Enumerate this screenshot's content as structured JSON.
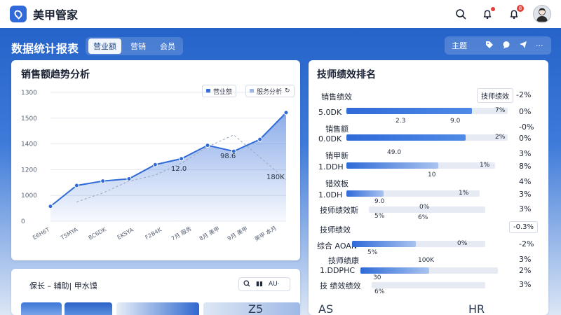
{
  "app": {
    "title": "美甲管家",
    "notification_badge": "8"
  },
  "page": {
    "title": "数据统计报表",
    "tabs": [
      {
        "label": "营业额",
        "active": true
      },
      {
        "label": "营销"
      },
      {
        "label": "会员"
      }
    ],
    "toolbar": {
      "label": "主题"
    }
  },
  "sales_chart": {
    "title": "销售额趋势分析",
    "legend": [
      "营业额",
      "服务分析"
    ],
    "annotations": [
      "12.0",
      "98.6",
      "180K"
    ]
  },
  "chart_data": {
    "type": "area",
    "title": "销售额趋势分析",
    "yticks": [
      "0",
      "1000",
      "1200",
      "1400",
      "1500",
      "1300"
    ],
    "xticks": [
      "E6H6T",
      "T5MYA",
      "BC6DK",
      "EKSYA",
      "F2B4K",
      "7月 服务",
      "8月 美甲",
      "9月 美甲",
      "美甲 本月"
    ],
    "series": [
      {
        "values": [
          1000,
          1140,
          1170,
          1185,
          1280,
          1320,
          1410,
          1370,
          1450,
          1630
        ]
      }
    ],
    "secondary": [
      0,
      1030,
      1090,
      1170,
      1210,
      1290,
      1400,
      1480,
      1330,
      1180
    ],
    "ylim": [
      900,
      1700
    ]
  },
  "ranking": {
    "title": "技师绩效排名",
    "header_label": "技师绩效",
    "header_pct": "-2%",
    "rows": [
      {
        "label": "销售绩效",
        "pct": "0%"
      },
      {
        "label": "5.0DK",
        "bar_text": "7%",
        "pct": "0%",
        "value": 0.78
      },
      {
        "label": "销售额",
        "pct": "-0%"
      },
      {
        "label": "0.0DK",
        "bar_text": "2%",
        "pct": "0%",
        "value": 0.74
      },
      {
        "label": "销甲新",
        "pct": "3%"
      },
      {
        "label": "1.DDH",
        "bar_text": "1%",
        "pct": "8%",
        "value": 0.62
      },
      {
        "label": "错效板",
        "pct": "4%"
      },
      {
        "label": "1.0DH",
        "bar_text": "1%",
        "pct": "3%",
        "value": 0.28
      },
      {
        "label": "技师绩效斯",
        "pct": "3%"
      }
    ],
    "floats": [
      "2.3",
      "9.0",
      "49.0",
      "10",
      "9.0",
      "5%",
      "0%",
      "6%"
    ],
    "section2_label": "技师绩效",
    "section2_pct": "-0.3%",
    "rows2": [
      {
        "label": "综合 AOAN",
        "bar_text": "0%",
        "pct": "-2%",
        "value": 0.48
      },
      {
        "label": "技师绩康",
        "pct": "3%"
      },
      {
        "label": "1.DDPHC",
        "pct": "2%",
        "value": 0.5
      },
      {
        "label": "技 绩效绩效",
        "pct": "3%"
      }
    ],
    "floats2": [
      "5%",
      "100K",
      "30",
      "6%"
    ]
  },
  "bottom": {
    "title": "保长 – 辅助| 甲水馍",
    "action_label": "AU·"
  },
  "partials": [
    "Z5",
    "AS",
    "HR"
  ],
  "colors": {
    "brand": "#2f6ad8",
    "banner": "#2563c9",
    "badge": "#e2413a"
  }
}
